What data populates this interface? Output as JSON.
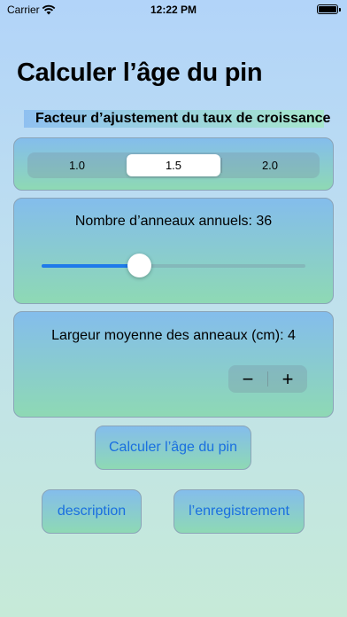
{
  "status_bar": {
    "carrier": "Carrier",
    "time": "12:22 PM"
  },
  "title": "Calculer l’âge du pin",
  "subtitle": "Facteur d’ajustement du taux de croissance",
  "segmented": {
    "options": [
      "1.0",
      "1.5",
      "2.0"
    ],
    "selected": "1.5"
  },
  "rings": {
    "label": "Nombre d’anneaux annuels: 36",
    "value": 36,
    "slider_fraction": 0.37
  },
  "width": {
    "label": "Largeur moyenne des anneaux (cm): 4",
    "value": 4,
    "minus": "−",
    "plus": "+"
  },
  "buttons": {
    "calculate": "Calculer l’âge du pin",
    "description": "description",
    "save": "l’enregistrement"
  },
  "colors": {
    "accent": "#1f7aea",
    "button_text": "#1a6fe0"
  }
}
